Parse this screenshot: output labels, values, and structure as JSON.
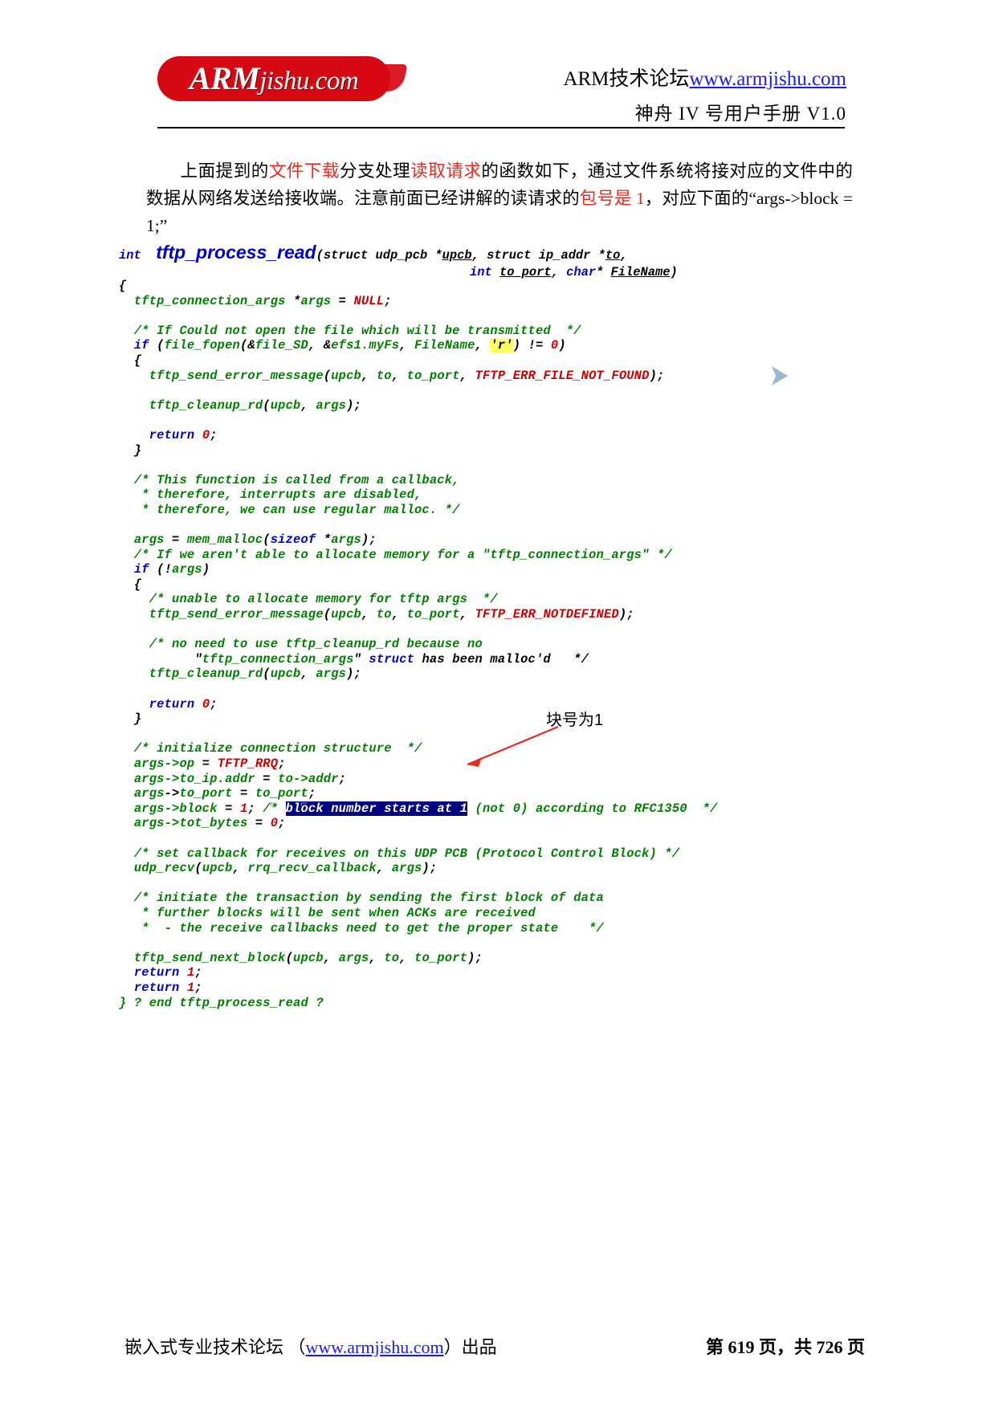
{
  "header": {
    "logo_text_arm": "ARM",
    "logo_text_rest": "jishu.com",
    "title_prefix": "ARM技术论坛",
    "title_url": "www.armjishu.com",
    "subtitle": "神舟 IV 号用户手册 V1.0"
  },
  "paragraph": {
    "seg1": "上面提到的",
    "seg2_red": "文件下载",
    "seg3": "分支处理",
    "seg4_red": "读取请求",
    "seg5": "的函数如下，通过文件系统将接对应的文件中的数据从网络发送给接收端。注意前面已经讲解的读请求的",
    "seg6_red": "包号是 1",
    "seg7": "，对应下面的",
    "seg8": "“args->block = 1;”"
  },
  "code": {
    "signature": {
      "ret_type": "int",
      "name": "tftp_process_read",
      "params_line1": "(struct udp_pcb *upcb, struct ip_addr *to,",
      "params_line2": "int to_port, char* FileName)"
    },
    "lines": [
      "{",
      "  tftp_connection_args *args = NULL;",
      "",
      "  /* If Could not open the file which will be transmitted  */",
      "  if (file_fopen(&file_SD, &efs1.myFs, FileName, 'r') != 0)",
      "  {",
      "    tftp_send_error_message(upcb, to, to_port, TFTP_ERR_FILE_NOT_FOUND);",
      "",
      "    tftp_cleanup_rd(upcb, args);",
      "",
      "    return 0;",
      "  }",
      "",
      "  /* This function is called from a callback,",
      "   * therefore, interrupts are disabled,",
      "   * therefore, we can use regular malloc. */",
      "",
      "  args = mem_malloc(sizeof *args);",
      "  /* If we aren't able to allocate memory for a \"tftp_connection_args\" */",
      "  if (!args)",
      "  {",
      "    /* unable to allocate memory for tftp args  */",
      "    tftp_send_error_message(upcb, to, to_port, TFTP_ERR_NOTDEFINED);",
      "",
      "    /* no need to use tftp_cleanup_rd because no",
      "          \"tftp_connection_args\" struct has been malloc'd   */",
      "    tftp_cleanup_rd(upcb, args);",
      "",
      "    return 0;",
      "  }",
      "",
      "  /* initialize connection structure  */",
      "  args->op = TFTP_RRQ;",
      "  args->to_ip.addr = to->addr;",
      "  args->to_port = to_port;",
      "  args->block = 1; /* block number starts at 1 (not 0) according to RFC1350  */",
      "  args->tot_bytes = 0;",
      "",
      "  /* set callback for receives on this UDP PCB (Protocol Control Block) */",
      "  udp_recv(upcb, rrq_recv_callback, args);",
      "",
      "  /* initiate the transaction by sending the first block of data",
      "   * further blocks will be sent when ACKs are received",
      "   *  - the receive callbacks need to get the proper state    */",
      "",
      "  tftp_send_next_block(upcb, args, to, to_port);",
      "",
      "  return 1;",
      "} ? end tftp_process_read ?"
    ],
    "highlight_char": "r",
    "selection_text": "block number starts at 1"
  },
  "annotation": {
    "label": "块号为1"
  },
  "footer": {
    "left_prefix": "嵌入式专业技术论坛 （",
    "left_url": "www.armjishu.com",
    "left_suffix": "）出品",
    "page_current": "619",
    "page_total": "726",
    "page_prefix": "第",
    "page_mid": "页，共",
    "page_suffix": "页"
  },
  "colors": {
    "brand_red": "#d60812",
    "text_red": "#e8291d",
    "code_blue": "#0000cc",
    "code_green": "#008000",
    "code_red": "#cc0000",
    "link_blue": "#1a1aff",
    "selection": "#000080",
    "highlight": "#ffff66"
  }
}
